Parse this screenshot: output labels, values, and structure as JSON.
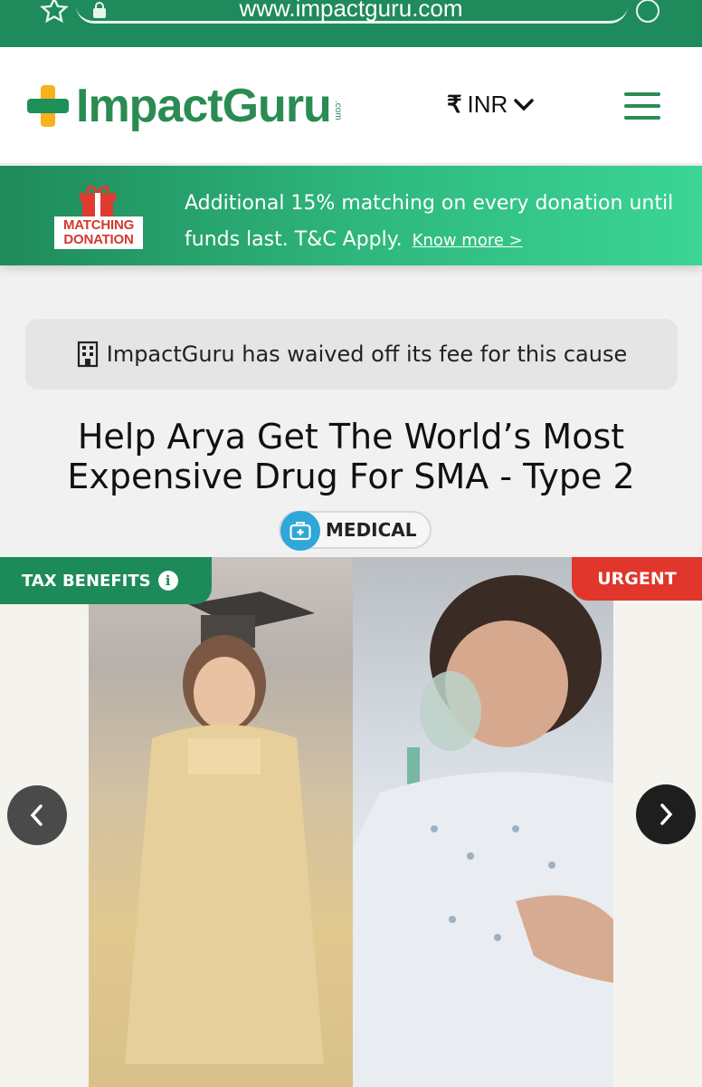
{
  "browser": {
    "url": "www.impactguru.com"
  },
  "header": {
    "logo_text": "ImpactGuru",
    "logo_suffix": ".com",
    "currency_symbol": "₹",
    "currency_code": "INR"
  },
  "banner": {
    "badge_line1": "MATCHING",
    "badge_line2": "DONATION",
    "text": "Additional 15% matching on every donation until funds last. T&C Apply.",
    "link": "Know more >"
  },
  "waiver": {
    "text": "ImpactGuru has waived off its fee for this cause"
  },
  "campaign": {
    "title_line1": "Help Arya Get The World’s Most",
    "title_line2": "Expensive Drug For SMA - Type 2",
    "category": "MEDICAL"
  },
  "carousel": {
    "tax_badge": "TAX BENEFITS",
    "urgent_badge": "URGENT"
  },
  "colors": {
    "brand_green": "#1f8a5b",
    "urgent_red": "#e0362b",
    "medical_blue": "#2fa7d8"
  }
}
